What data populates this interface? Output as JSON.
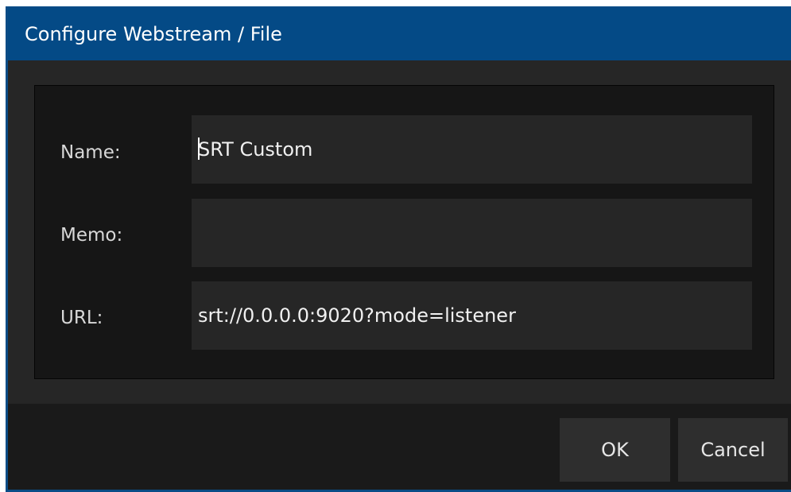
{
  "window": {
    "title": "Configure Webstream / File"
  },
  "form": {
    "fields": [
      {
        "label": "Name:",
        "value": "SRT Custom"
      },
      {
        "label": "Memo:",
        "value": ""
      },
      {
        "label": "URL:",
        "value": "srt://0.0.0.0:9020?mode=listener"
      }
    ]
  },
  "buttons": {
    "ok_label": "OK",
    "cancel_label": "Cancel"
  },
  "colors": {
    "titlebar": "#044a86",
    "background": "#1f1f1f",
    "group_box": "#161616",
    "input": "#262626",
    "button": "#2e2e2e",
    "text": "#d8d8d8"
  }
}
